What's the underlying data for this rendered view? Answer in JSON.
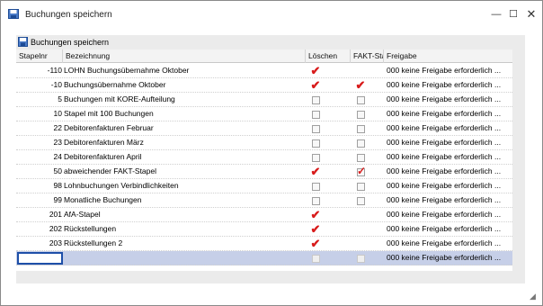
{
  "window": {
    "title": "Buchungen speichern"
  },
  "toolbar": {
    "save_label": "Buchungen speichern"
  },
  "columns": {
    "nr": "Stapelnr",
    "bez": "Bezeichnung",
    "loeschen": "Löschen",
    "fakt": "FAKT-Sta...",
    "freigabe": "Freigabe"
  },
  "rows": [
    {
      "nr": "-110",
      "bez": "LOHN Buchungsübernahme Oktober",
      "loeschen": true,
      "fakt": null,
      "freigabe": "000  keine Freigabe erforderlich  ..."
    },
    {
      "nr": "-10",
      "bez": "Buchungsübernahme Oktober",
      "loeschen": true,
      "fakt": true,
      "freigabe": "000  keine Freigabe erforderlich  ..."
    },
    {
      "nr": "5",
      "bez": "Buchungen mit KORE-Aufteilung",
      "loeschen": false,
      "fakt": false,
      "freigabe": "000  keine Freigabe erforderlich  ..."
    },
    {
      "nr": "10",
      "bez": "Stapel mit 100 Buchungen",
      "loeschen": false,
      "fakt": false,
      "freigabe": "000  keine Freigabe erforderlich  ..."
    },
    {
      "nr": "22",
      "bez": "Debitorenfakturen Februar",
      "loeschen": false,
      "fakt": false,
      "freigabe": "000  keine Freigabe erforderlich  ..."
    },
    {
      "nr": "23",
      "bez": "Debitorenfakturen März",
      "loeschen": false,
      "fakt": false,
      "freigabe": "000  keine Freigabe erforderlich  ..."
    },
    {
      "nr": "24",
      "bez": "Debitorenfakturen April",
      "loeschen": false,
      "fakt": false,
      "freigabe": "000  keine Freigabe erforderlich  ..."
    },
    {
      "nr": "50",
      "bez": "abweichender FAKT-Stapel",
      "loeschen": true,
      "fakt": "box-checked",
      "freigabe": "000  keine Freigabe erforderlich  ..."
    },
    {
      "nr": "98",
      "bez": "Lohnbuchungen Verbindlichkeiten",
      "loeschen": false,
      "fakt": false,
      "freigabe": "000  keine Freigabe erforderlich  ..."
    },
    {
      "nr": "99",
      "bez": "Monatliche Buchungen",
      "loeschen": false,
      "fakt": false,
      "freigabe": "000  keine Freigabe erforderlich  ..."
    },
    {
      "nr": "201",
      "bez": "AfA-Stapel",
      "loeschen": true,
      "fakt": null,
      "freigabe": "000  keine Freigabe erforderlich  ..."
    },
    {
      "nr": "202",
      "bez": "Rückstellungen",
      "loeschen": true,
      "fakt": null,
      "freigabe": "000  keine Freigabe erforderlich  ..."
    },
    {
      "nr": "203",
      "bez": "Rückstellungen 2",
      "loeschen": true,
      "fakt": null,
      "freigabe": "000  keine Freigabe erforderlich  ..."
    }
  ],
  "new_row": {
    "nr": "",
    "freigabe": "000  keine Freigabe erforderlich  ..."
  },
  "icons": {
    "app": "save-disk-icon",
    "minimize": "minimize-icon",
    "maximize": "maximize-icon",
    "close": "close-icon",
    "resize": "resize-grip-icon"
  },
  "colors": {
    "checkmark": "#d81c1c",
    "selection": "#c6cfe8",
    "focus_border": "#1e4fa8"
  }
}
